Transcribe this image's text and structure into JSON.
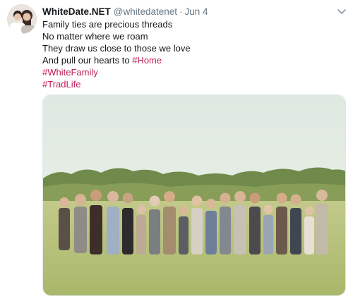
{
  "tweet": {
    "display_name": "WhiteDate.NET",
    "handle": "@whitedatenet",
    "separator": "·",
    "time": "Jun 4",
    "lines": [
      "Family ties are precious threads",
      "No matter where we roam",
      "They draw us close to those we love"
    ],
    "last_line_prefix": "And pull our hearts to ",
    "hashtag_home": "#Home",
    "hashtags": [
      "#WhiteFamily",
      "#TradLife"
    ]
  },
  "icons": {
    "menu": "chevron-down-icon",
    "avatar": "profile-photo"
  },
  "colors": {
    "link": "#c01e5a",
    "meta": "#657786",
    "text": "#14171a",
    "sky": "#e7efe6",
    "grass": "#b9c27a",
    "trees": "#6f8a4a"
  }
}
